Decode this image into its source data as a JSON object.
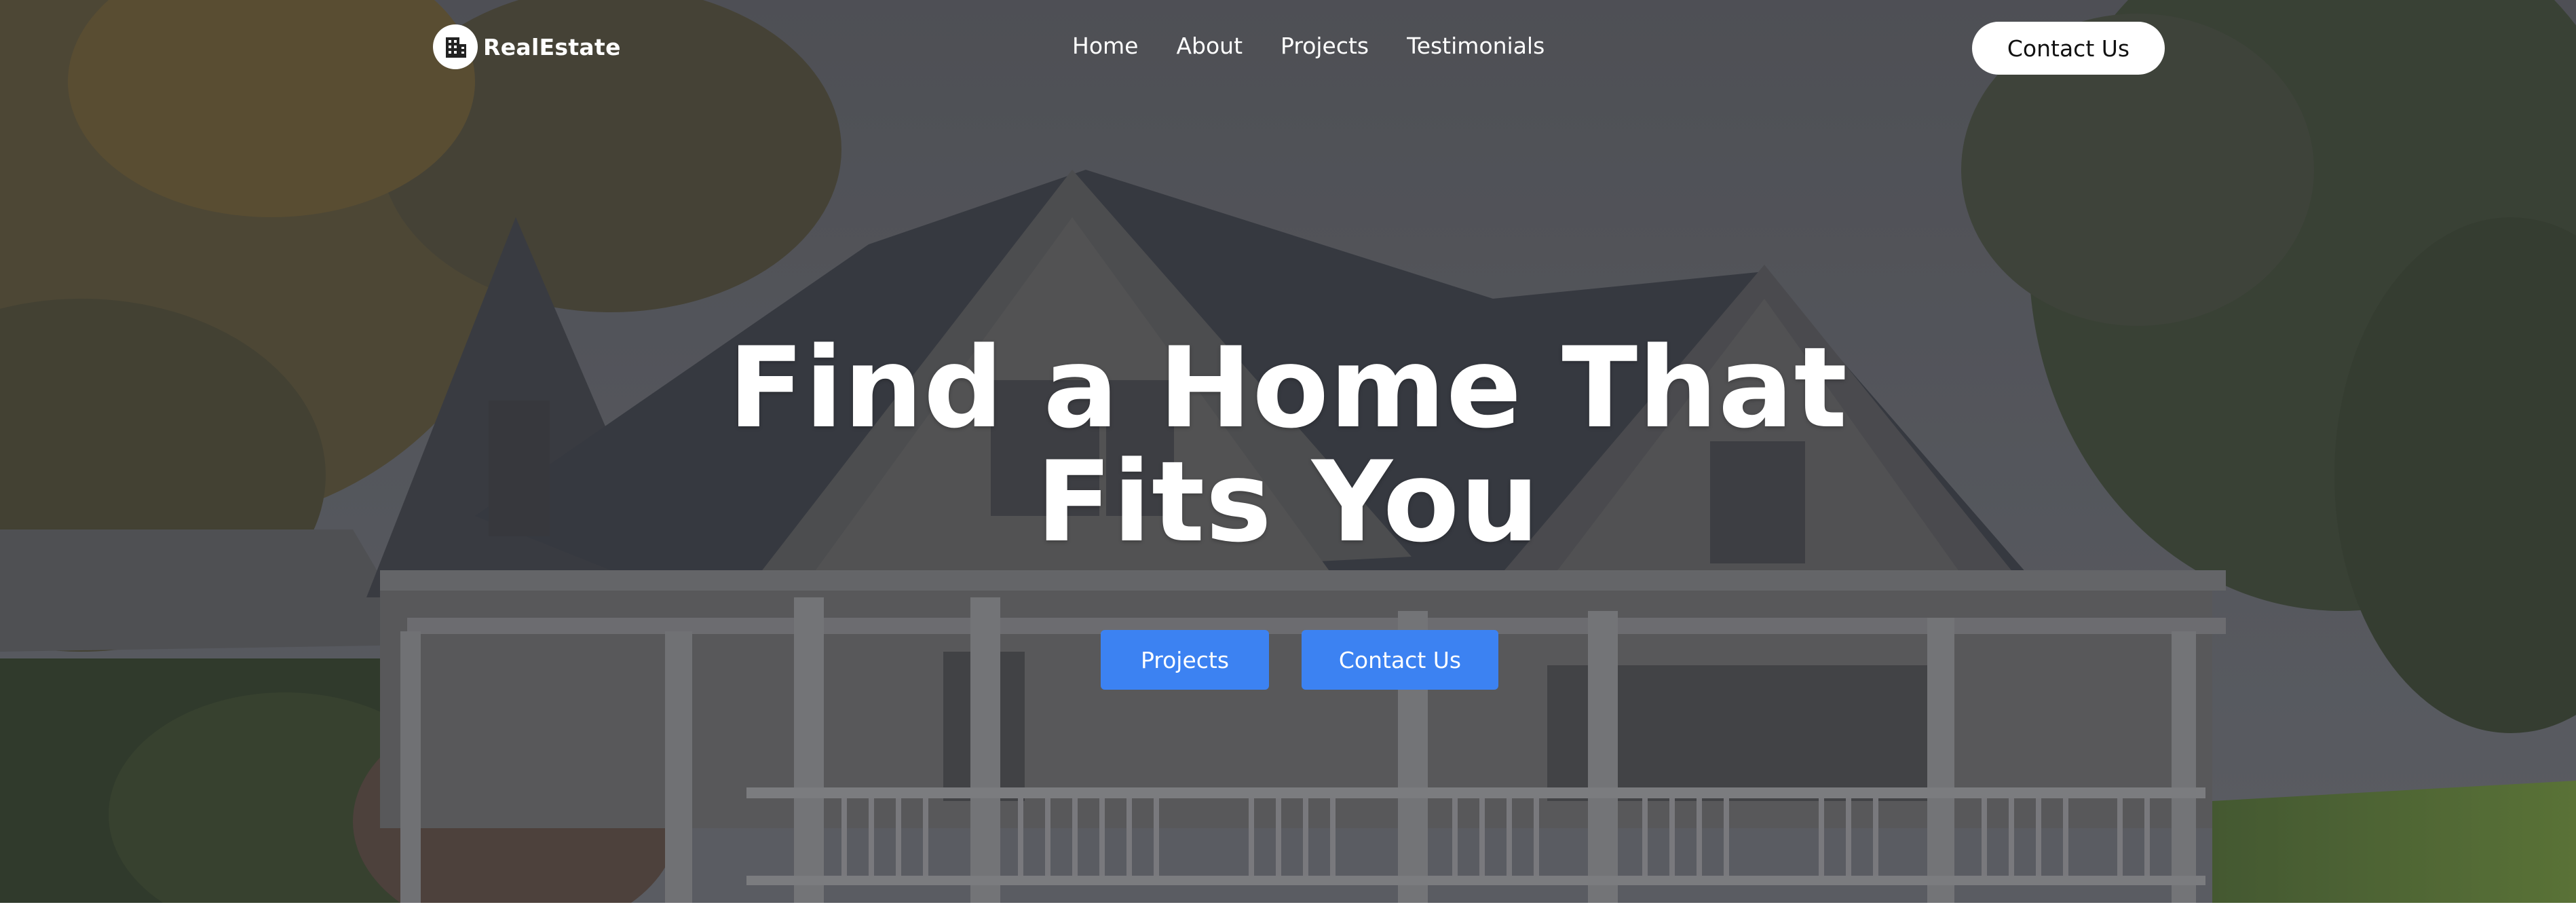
{
  "brand": {
    "name": "RealEstate",
    "logo_icon": "building-icon"
  },
  "nav": {
    "items": [
      {
        "label": "Home"
      },
      {
        "label": "About"
      },
      {
        "label": "Projects"
      },
      {
        "label": "Testimonials"
      }
    ],
    "cta_label": "Contact Us"
  },
  "hero": {
    "title_line1": "Find a Home That",
    "title_line2": "Fits You",
    "buttons": {
      "primary": "Projects",
      "secondary": "Contact Us"
    }
  },
  "colors": {
    "accent": "#3c82f2",
    "overlay": "#4a4c52"
  }
}
